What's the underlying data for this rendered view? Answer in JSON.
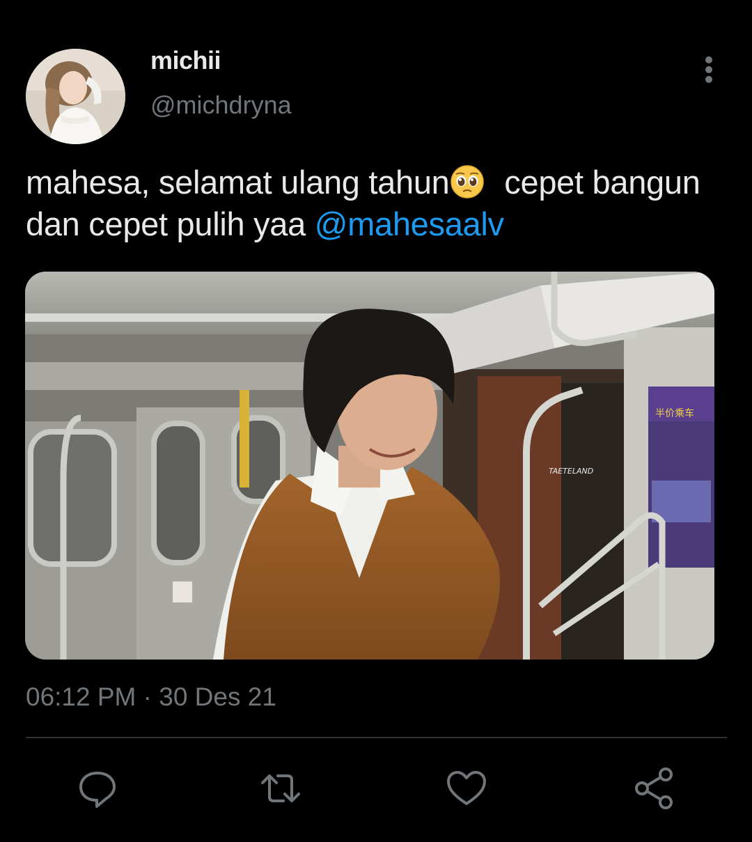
{
  "author": {
    "display_name": "michii",
    "handle": "@michdryna",
    "avatar_icon": "profile-photo"
  },
  "tweet": {
    "text_part1": "mahesa, selamat ulang tahun",
    "emoji": "pleading-face",
    "text_part2": " cepet bangun dan cepet pulih yaa ",
    "mention": "@mahesaalv",
    "media_caption": "TAETELAND",
    "media_sign_text": "半价乘车",
    "timestamp": "06:12 PM · 30 Des 21"
  },
  "actions": [
    {
      "name": "reply",
      "icon": "comment-icon"
    },
    {
      "name": "retweet",
      "icon": "retweet-icon"
    },
    {
      "name": "like",
      "icon": "heart-icon"
    },
    {
      "name": "share",
      "icon": "share-icon"
    }
  ],
  "colors": {
    "background": "#000000",
    "primary_text": "#e7e9ea",
    "secondary_text": "#71767b",
    "link": "#1d9bf0",
    "divider": "#2f3336"
  }
}
